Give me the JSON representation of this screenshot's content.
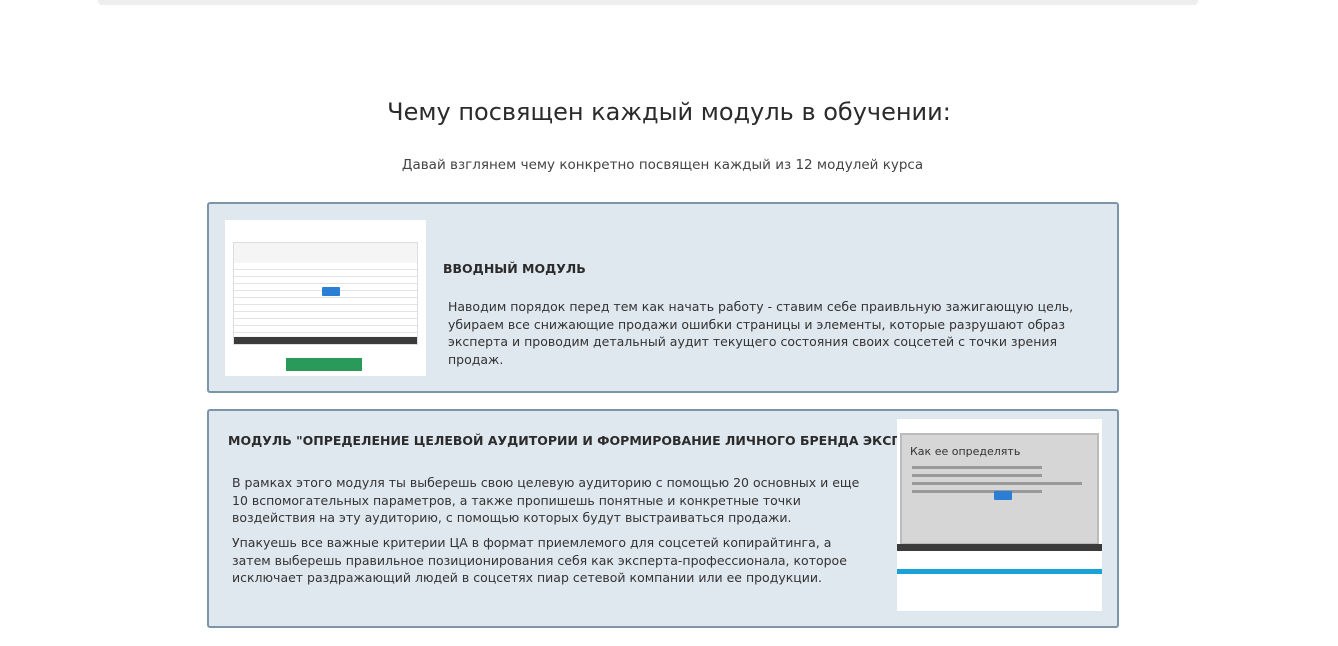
{
  "heading": "Чему посвящен каждый модуль в обучении:",
  "subheading": "Давай взглянем чему конкретно посвящен каждый из 12 модулей курса",
  "modules": [
    {
      "title": "ВВОДНЫЙ МОДУЛЬ",
      "paragraphs": [
        "Наводим порядок перед тем как начать работу - ставим себе праивльную  зажигающую цель, убираем все снижающие продажи ошибки страницы и элементы, которые разрушают образ эксперта и проводим детальный аудит текущего состояния своих соцсетей с точки зрения продаж."
      ]
    },
    {
      "title": "МОДУЛЬ \"ОПРЕДЕЛЕНИЕ ЦЕЛЕВОЙ АУДИТОРИИ И ФОРМИРОВАНИЕ ЛИЧНОГО БРЕНДА ЭКСПЕРТА\"",
      "paragraphs": [
        "В рамках этого модуля ты выберешь свою целевую аудиторию с помощью  20 основных и еще 10 вспомогательных параметров, а также пропишешь понятные и конкретные точки воздействия на эту аудиторию, с помощью которых будут выстраиваться продажи.",
        "Упакуешь все важные критерии ЦА в формат приемлемого для  соцсетей копирайтинга, а затем выберешь правильное позиционирования себя как эксперта-профессионала, которое исключает раздражающий людей в соцсетях пиар сетевой компании или ее продукции."
      ],
      "slide_title": "Как ее определять"
    }
  ]
}
